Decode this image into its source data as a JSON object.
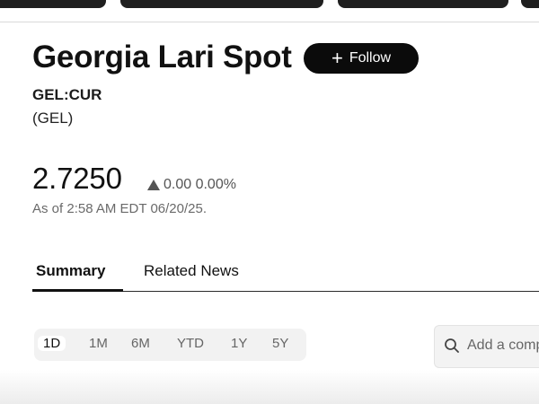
{
  "quote": {
    "title": "Georgia Lari Spot",
    "ticker": "GEL:CUR",
    "currency": "(GEL)",
    "price": "2.7250",
    "change": "0.00 0.00%",
    "as_of": "As of 2:58 AM EDT 06/20/25."
  },
  "follow": {
    "label": "Follow"
  },
  "tabs": [
    {
      "label": "Summary"
    },
    {
      "label": "Related News"
    }
  ],
  "ranges": [
    "1D",
    "1M",
    "6M",
    "YTD",
    "1Y",
    "5Y"
  ],
  "search": {
    "placeholder": "Add a comp"
  },
  "colors": {
    "button_bg": "#0b0b0b",
    "text": "#111111"
  },
  "icons": {
    "follow": "plus-icon",
    "search": "search-icon",
    "change": "triangle-up-icon"
  }
}
